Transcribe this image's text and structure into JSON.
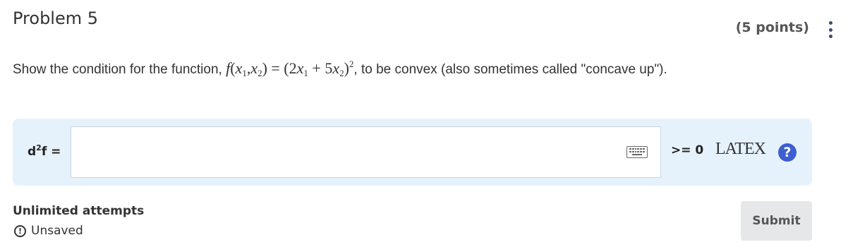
{
  "header": {
    "title": "Problem 5",
    "points": "(5 points)",
    "menu_icon": "kebab-menu-icon"
  },
  "question": {
    "prefix": "Show the condition for the function, ",
    "math": {
      "f": "f",
      "open": "(",
      "x": "x",
      "sub1": "1",
      "comma": ",",
      "sub2": "2",
      "eq_open": ") = (2",
      "plus": " + 5",
      "close": ")",
      "exp": "2"
    },
    "suffix": ", to be convex (also sometimes called \"concave up\")."
  },
  "answer": {
    "lhs_text": "d",
    "lhs_sup": "2",
    "lhs_rest": "f =",
    "input_value": "",
    "keyboard_icon": "keyboard-icon",
    "rhs": ">= 0",
    "latex_label": "LATEX",
    "help_label": "?"
  },
  "footer": {
    "attempts": "Unlimited attempts",
    "status_icon": "!",
    "status": "Unsaved",
    "submit": "Submit"
  },
  "colors": {
    "answer_bg": "#e6f2fb",
    "help_blue": "#3d5fd0",
    "submit_bg": "#e5e7e8"
  }
}
